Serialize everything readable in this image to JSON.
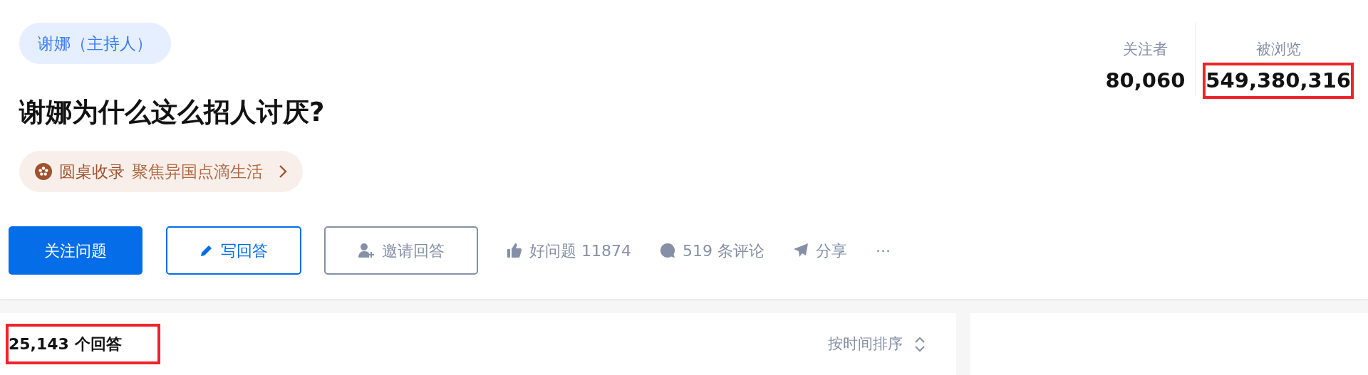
{
  "question": {
    "topic_tag": "谢娜（主持人）",
    "title": "谢娜为什么这么招人讨厌?",
    "roundtable": {
      "label": "圆桌收录",
      "name": "聚焦异国点滴生活"
    }
  },
  "stats": [
    {
      "label": "关注者",
      "value": "80,060",
      "highlighted": false
    },
    {
      "label": "被浏览",
      "value": "549,380,316",
      "highlighted": true
    }
  ],
  "actions": [
    {
      "kind": "follow",
      "label": "关注问题"
    },
    {
      "kind": "write",
      "label": "写回答"
    },
    {
      "kind": "invite",
      "label": "邀请回答"
    },
    {
      "kind": "vote",
      "label": "好问题 11874"
    },
    {
      "kind": "comment",
      "label": "519 条评论"
    },
    {
      "kind": "share",
      "label": "分享"
    },
    {
      "kind": "more",
      "label": "···"
    }
  ],
  "answers": {
    "count": "25,143 个回答",
    "highlighted": true,
    "sort": "按时间排序"
  }
}
